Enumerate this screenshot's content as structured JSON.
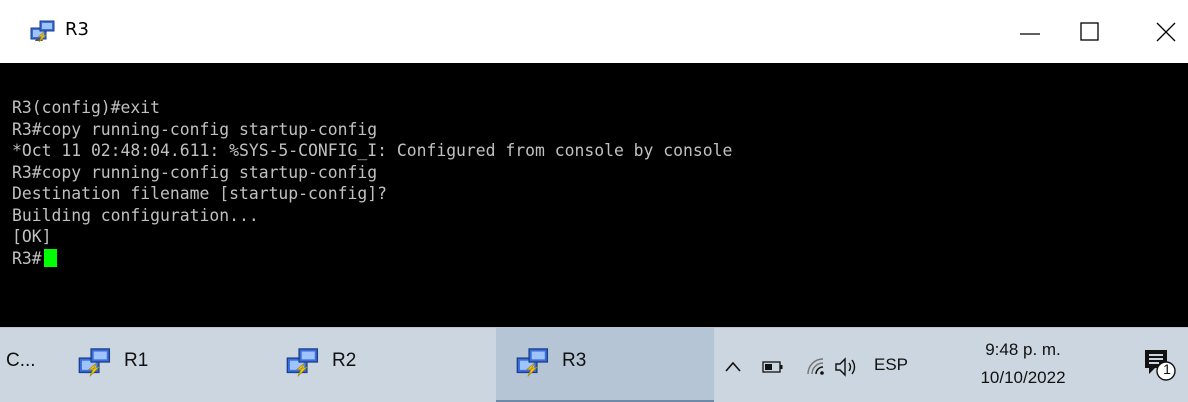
{
  "window": {
    "title": "R3",
    "controls": {
      "minimize": "minimize-icon",
      "maximize": "maximize-icon",
      "close": "close-icon"
    }
  },
  "console": {
    "lines": [
      "R3(config)#exit",
      "R3#copy running-config startup-config",
      "*Oct 11 02:48:04.611: %SYS-5-CONFIG_I: Configured from console by console",
      "R3#copy running-config startup-config",
      "Destination filename [startup-config]?",
      "Building configuration...",
      "[OK]",
      "R3#"
    ],
    "cursor_color": "#00ff00"
  },
  "taskbar": {
    "items": [
      {
        "label": "C...",
        "icon": ""
      },
      {
        "label": "R1",
        "icon": "router-terminal-icon"
      },
      {
        "label": "R2",
        "icon": "router-terminal-icon"
      },
      {
        "label": "R3",
        "icon": "router-terminal-icon",
        "active": true
      }
    ],
    "tray": {
      "chevron": "chevron-up-icon",
      "battery": "battery-icon",
      "wifi": "wifi-icon",
      "volume": "volume-icon",
      "language": "ESP",
      "time": "9:48 p. m.",
      "date": "10/10/2022",
      "notifications": {
        "icon": "notification-icon",
        "count": "1"
      }
    }
  }
}
